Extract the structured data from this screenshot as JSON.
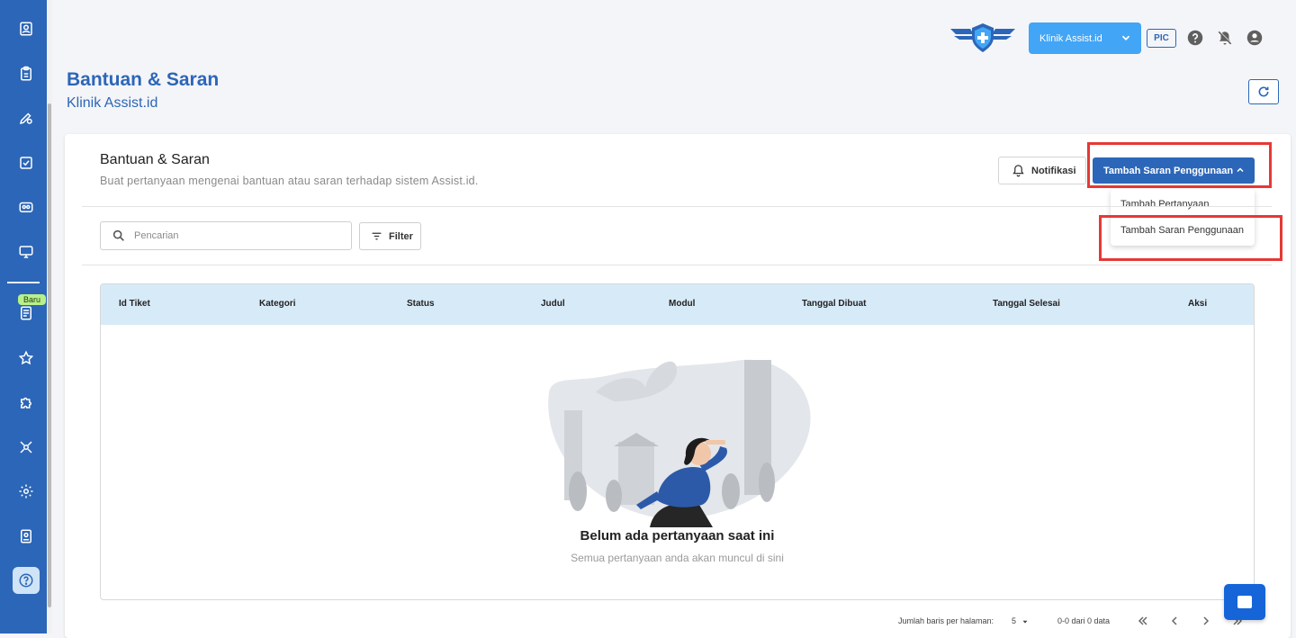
{
  "sidebar": {
    "icons": [
      "user-card-icon",
      "clipboard-icon",
      "pencil-cog-icon",
      "checklist-icon",
      "id-badge-icon",
      "monitor-icon",
      "document-icon",
      "star-icon",
      "puzzle-icon",
      "network-icon",
      "gear-icon",
      "report-icon",
      "help-icon"
    ],
    "new_badge": "Baru",
    "active": "help-icon"
  },
  "topbar": {
    "clinic_select": "Klinik Assist.id",
    "role_badge": "PIC"
  },
  "header": {
    "title": "Bantuan & Saran",
    "subtitle": "Klinik Assist.id"
  },
  "card": {
    "title": "Bantuan & Saran",
    "description": "Buat pertanyaan mengenai bantuan atau saran terhadap sistem Assist.id.",
    "notif_label": "Notifikasi",
    "add_label": "Tambah Saran Penggunaan",
    "dropdown": [
      "Tambah Pertanyaan",
      "Tambah Saran Penggunaan"
    ]
  },
  "search": {
    "placeholder": "Pencarian",
    "value": ""
  },
  "filter_label": "Filter",
  "table": {
    "columns": [
      "Id Tiket",
      "Kategori",
      "Status",
      "Judul",
      "Modul",
      "Tanggal Dibuat",
      "Tanggal Selesai",
      "Aksi"
    ],
    "rows": [],
    "empty_title": "Belum ada pertanyaan saat ini",
    "empty_sub": "Semua pertanyaan anda akan muncul di sini"
  },
  "pagination": {
    "rows_label": "Jumlah baris per halaman:",
    "rows_value": "5",
    "count": "0-0 dari 0 data"
  },
  "colors": {
    "primary": "#2c66b8",
    "accent": "#42a5f5",
    "highlight": "#e53935",
    "header_bg": "#d7eaf8"
  }
}
